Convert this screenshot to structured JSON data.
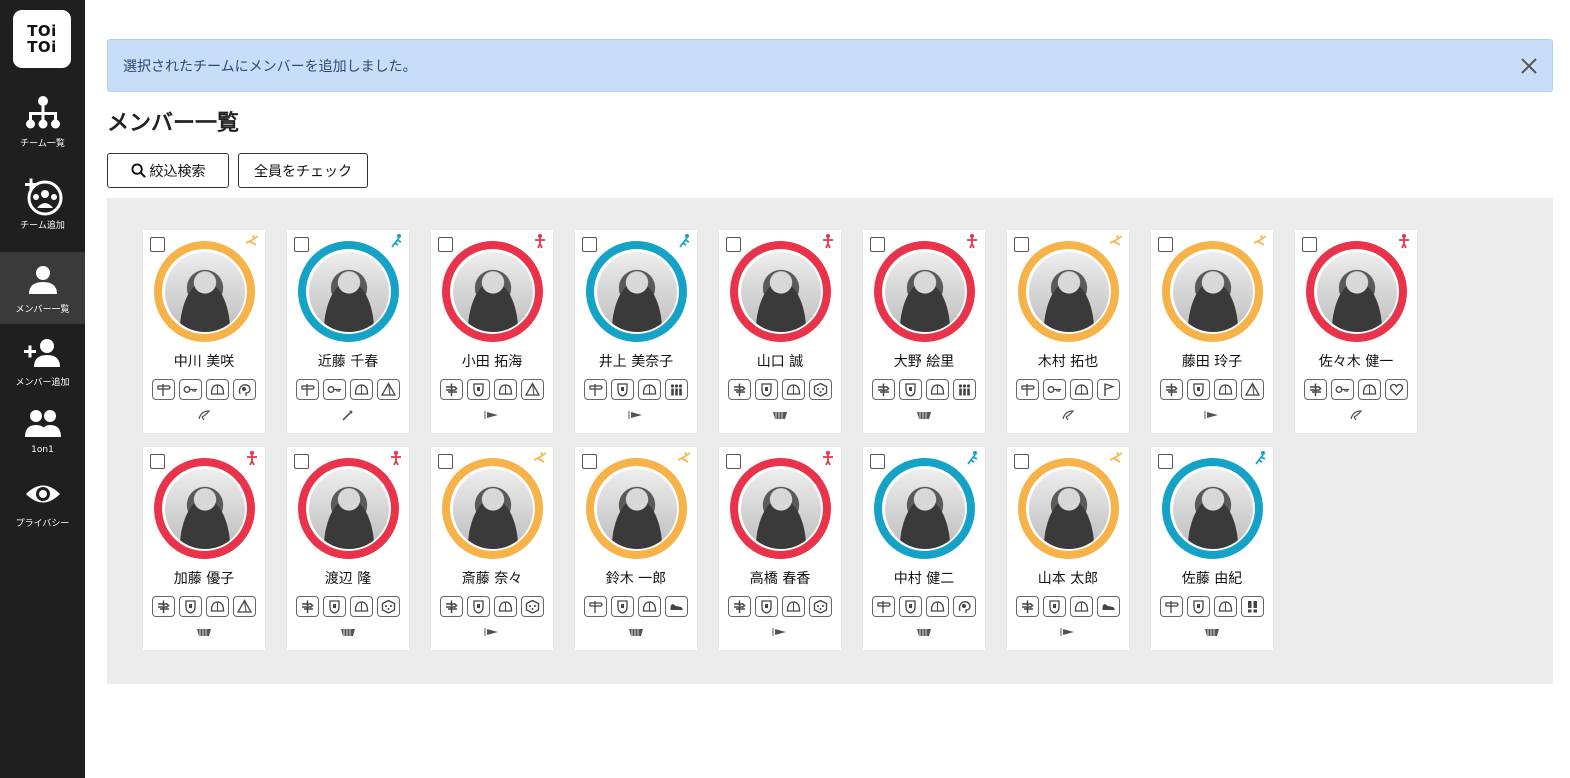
{
  "app": {
    "logo_line1": "TOi",
    "logo_line2": "TOi"
  },
  "sidebar": {
    "items": [
      {
        "label": "チーム一覧",
        "icon": "team-tree-icon"
      },
      {
        "label": "チーム追加",
        "icon": "team-add-icon"
      },
      {
        "label": "メンバー一覧",
        "icon": "member-icon",
        "active": true
      },
      {
        "label": "メンバー追加",
        "icon": "member-add-icon"
      },
      {
        "label": "1on1",
        "icon": "people-icon"
      },
      {
        "label": "プライバシー",
        "icon": "eye-icon"
      }
    ]
  },
  "alert": {
    "message": "選択されたチームにメンバーを追加しました。"
  },
  "page": {
    "title": "メンバー一覧",
    "filter_button": "絞込検索",
    "check_all_button": "全員をチェック"
  },
  "colors": {
    "orange": "#f7b24a",
    "blue": "#14a3c7",
    "red": "#e8334a"
  },
  "members": [
    {
      "name": "中川 美咲",
      "ring": "orange",
      "type": "orange",
      "badges": [
        "signpost",
        "key",
        "dome",
        "brain"
      ],
      "sub": "leaf"
    },
    {
      "name": "近藤 千春",
      "ring": "blue",
      "type": "blue",
      "badges": [
        "signpost",
        "key",
        "dome",
        "pyramid"
      ],
      "sub": "pen"
    },
    {
      "name": "小田 拓海",
      "ring": "red",
      "type": "red",
      "badges": [
        "cross",
        "shield",
        "dome",
        "pyramid"
      ],
      "sub": "flag"
    },
    {
      "name": "井上 美奈子",
      "ring": "blue",
      "type": "blue",
      "badges": [
        "signpost",
        "shield",
        "dome",
        "group"
      ],
      "sub": "flag"
    },
    {
      "name": "山口 誠",
      "ring": "red",
      "type": "red",
      "badges": [
        "cross",
        "shield",
        "dome",
        "cube"
      ],
      "sub": "cards"
    },
    {
      "name": "大野 絵里",
      "ring": "red",
      "type": "red",
      "badges": [
        "cross",
        "shield",
        "dome",
        "group"
      ],
      "sub": "cards"
    },
    {
      "name": "木村 拓也",
      "ring": "orange",
      "type": "orange",
      "badges": [
        "signpost",
        "key",
        "dome",
        "flagpole"
      ],
      "sub": "leaf"
    },
    {
      "name": "藤田 玲子",
      "ring": "orange",
      "type": "orange",
      "badges": [
        "cross",
        "shield",
        "dome",
        "pyramid"
      ],
      "sub": "flag"
    },
    {
      "name": "佐々木 健一",
      "ring": "red",
      "type": "red",
      "badges": [
        "cross",
        "key",
        "dome",
        "heart"
      ],
      "sub": "leaf"
    },
    {
      "name": "加藤 優子",
      "ring": "red",
      "type": "red",
      "badges": [
        "cross",
        "shield",
        "dome",
        "pyramid"
      ],
      "sub": "cards"
    },
    {
      "name": "渡辺 隆",
      "ring": "red",
      "type": "red",
      "badges": [
        "cross",
        "shield",
        "dome",
        "cube"
      ],
      "sub": "cards"
    },
    {
      "name": "斎藤 奈々",
      "ring": "orange",
      "type": "orange",
      "badges": [
        "cross",
        "shield",
        "dome",
        "cube"
      ],
      "sub": "flag"
    },
    {
      "name": "鈴木 一郎",
      "ring": "orange",
      "type": "orange",
      "badges": [
        "signpost",
        "shield",
        "dome",
        "shoe"
      ],
      "sub": "cards"
    },
    {
      "name": "高橋 春香",
      "ring": "red",
      "type": "red",
      "badges": [
        "cross",
        "shield",
        "dome",
        "cube"
      ],
      "sub": "flag"
    },
    {
      "name": "中村 健二",
      "ring": "blue",
      "type": "blue",
      "badges": [
        "signpost",
        "shield",
        "dome",
        "brain"
      ],
      "sub": "cards"
    },
    {
      "name": "山本 太郎",
      "ring": "orange",
      "type": "orange",
      "badges": [
        "cross",
        "shield",
        "dome",
        "shoe"
      ],
      "sub": "flag"
    },
    {
      "name": "佐藤 由紀",
      "ring": "blue",
      "type": "blue",
      "badges": [
        "signpost",
        "shield",
        "dome",
        "exclaim"
      ],
      "sub": "cards"
    }
  ]
}
